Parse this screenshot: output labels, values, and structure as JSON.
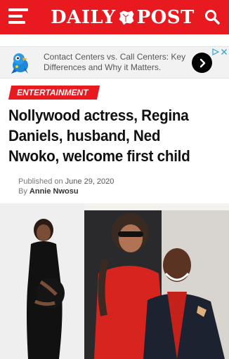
{
  "header": {
    "logo_left": "DAILY",
    "logo_right": "POST",
    "icons": {
      "menu": "hamburger-menu-icon",
      "search": "search-icon",
      "logo_mark": "nigeria-map-icon"
    },
    "colors": {
      "brand": "#e8191f",
      "text_on_brand": "#ffffff"
    }
  },
  "ad": {
    "text": "Contact Centers vs. Call Centers: Key Differences and Why it Matters.",
    "icons": {
      "logo": "parrot-logo-icon",
      "arrow": "chevron-right-icon",
      "close": "close-icon",
      "info": "ad-info-icon"
    }
  },
  "article": {
    "category": "ENTERTAINMENT",
    "headline": "Nollywood actress, Regina Daniels, husband, Ned Nwoko, welcome first child",
    "published_prefix": "Published on",
    "published_date": "June 29, 2020",
    "by_prefix": "By",
    "author": "Annie Nwosu"
  }
}
